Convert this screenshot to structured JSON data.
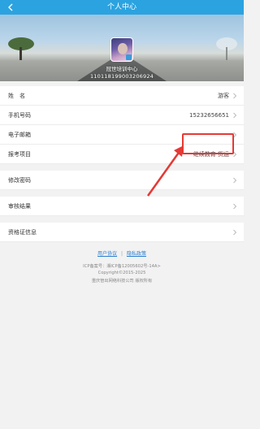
{
  "header": {
    "title": "个人中心"
  },
  "profile": {
    "org": "冠世培训中心",
    "id_number": "110118199003206924"
  },
  "rows": [
    {
      "label": "姓　名",
      "value": "游客"
    },
    {
      "label": "手机号码",
      "value": "15232656651"
    },
    {
      "label": "电子邮箱",
      "value": ""
    },
    {
      "label": "报考项目",
      "value": "继续教育·货运"
    }
  ],
  "menu": [
    {
      "label": "修改密码"
    },
    {
      "label": "审核结果"
    },
    {
      "label": "资格证信息"
    }
  ],
  "footer": {
    "user_agreement": "用户协议",
    "separator": "|",
    "privacy_policy": "隐私政策",
    "icp": "ICP备案号：湘ICP备12005602号-14A>",
    "copyright": "Copyright©2015-2025",
    "company": "重庆管出网络科技公司 版权所有"
  },
  "colors": {
    "header": "#2ba3e0",
    "highlight_box": "#e53935",
    "link": "#2a7ed0"
  },
  "icons": {
    "back": "chevron-left-icon",
    "row": "chevron-right-icon"
  }
}
